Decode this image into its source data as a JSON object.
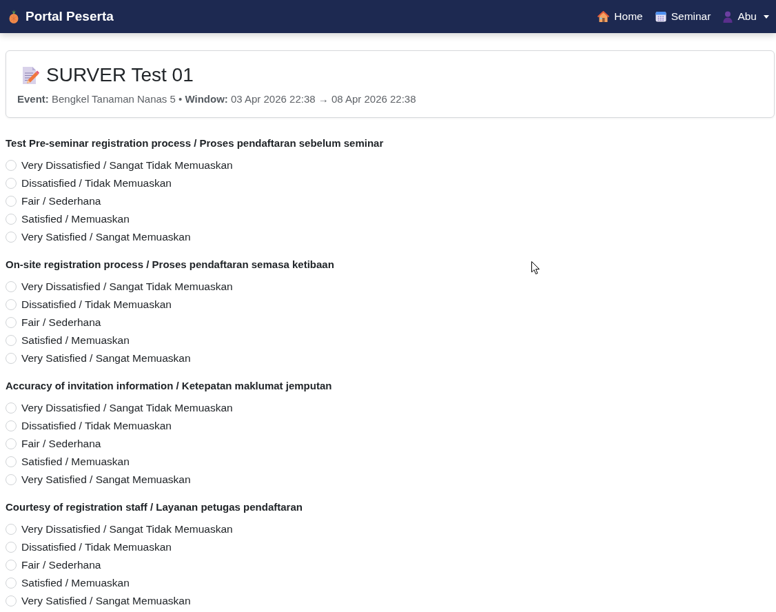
{
  "navbar": {
    "brand": "Portal Peserta",
    "links": [
      {
        "label": "Home"
      },
      {
        "label": "Seminar"
      }
    ],
    "user_menu": {
      "label": "Abu"
    }
  },
  "survey": {
    "title": "SURVER Test 01",
    "meta": "**Event:** Bengkel Tanaman Nanas 5 • **Window:** 03 Apr 2026 22:38 → 08 Apr 2026 22:38"
  },
  "questions": [
    {
      "title": "Test Pre-seminar registration process / Proses pendaftaran sebelum seminar",
      "options": [
        {
          "label": "Very Dissatisfied / Sangat Tidak Memuaskan",
          "selected": false
        },
        {
          "label": "Dissatisfied / Tidak Memuaskan",
          "selected": false
        },
        {
          "label": "Fair / Sederhana",
          "selected": false
        },
        {
          "label": "Satisfied / Memuaskan",
          "selected": false
        },
        {
          "label": "Very Satisfied / Sangat Memuaskan",
          "selected": false
        }
      ]
    },
    {
      "title": "On-site registration process / Proses pendaftaran semasa ketibaan",
      "options": [
        {
          "label": "Very Dissatisfied / Sangat Tidak Memuaskan",
          "selected": false
        },
        {
          "label": "Dissatisfied / Tidak Memuaskan",
          "selected": false
        },
        {
          "label": "Fair / Sederhana",
          "selected": false
        },
        {
          "label": "Satisfied / Memuaskan",
          "selected": false
        },
        {
          "label": "Very Satisfied / Sangat Memuaskan",
          "selected": false
        }
      ]
    },
    {
      "title": "Accuracy of invitation information / Ketepatan maklumat jemputan",
      "options": [
        {
          "label": "Very Dissatisfied / Sangat Tidak Memuaskan",
          "selected": false
        },
        {
          "label": "Dissatisfied / Tidak Memuaskan",
          "selected": false
        },
        {
          "label": "Fair / Sederhana",
          "selected": false
        },
        {
          "label": "Satisfied / Memuaskan",
          "selected": false
        },
        {
          "label": "Very Satisfied / Sangat Memuaskan",
          "selected": false
        }
      ]
    },
    {
      "title": "Courtesy of registration staff / Layanan petugas pendaftaran",
      "options": [
        {
          "label": "Very Dissatisfied / Sangat Tidak Memuaskan",
          "selected": false
        },
        {
          "label": "Dissatisfied / Tidak Memuaskan",
          "selected": false
        },
        {
          "label": "Fair / Sederhana",
          "selected": false
        },
        {
          "label": "Satisfied / Memuaskan",
          "selected": false
        },
        {
          "label": "Very Satisfied / Sangat Memuaskan",
          "selected": false
        }
      ]
    }
  ]
}
